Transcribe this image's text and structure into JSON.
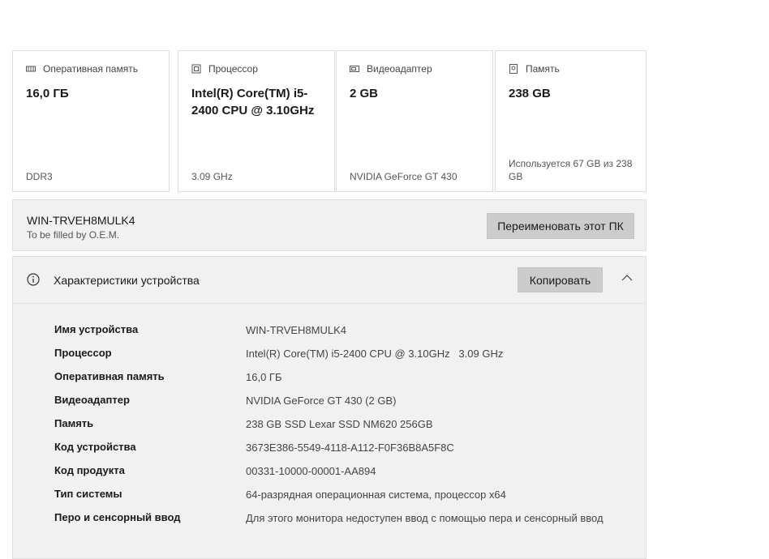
{
  "cards": [
    {
      "icon": "memory-icon",
      "label": "Оперативная память",
      "value": "16,0 ГБ",
      "sub": "DDR3"
    },
    {
      "icon": "processor-icon",
      "label": "Процессор",
      "value": "Intel(R) Core(TM) i5-2400 CPU @ 3.10GHz",
      "sub": "3.09 GHz"
    },
    {
      "icon": "gpu-icon",
      "label": "Видеоадаптер",
      "value": "2 GB",
      "sub": "NVIDIA GeForce GT 430"
    },
    {
      "icon": "storage-icon",
      "label": "Память",
      "value": "238 GB",
      "sub": "Используется 67 GB из 238 GB"
    }
  ],
  "pc": {
    "name": "WIN-TRVEH8MULK4",
    "oem": "To be filled by O.E.M.",
    "rename_label": "Переименовать этот ПК"
  },
  "specs": {
    "title": "Характеристики устройства",
    "copy_label": "Копировать",
    "rows": [
      {
        "k": "Имя устройства",
        "v": "WIN-TRVEH8MULK4"
      },
      {
        "k": "Процессор",
        "v": "Intel(R) Core(TM) i5-2400 CPU @ 3.10GHz   3.09 GHz"
      },
      {
        "k": "Оперативная память",
        "v": "16,0 ГБ"
      },
      {
        "k": "Видеоадаптер",
        "v": "NVIDIA GeForce GT 430 (2 GB)"
      },
      {
        "k": "Память",
        "v": "238 GB SSD Lexar SSD NM620 256GB"
      },
      {
        "k": "Код устройства",
        "v": "3673E386-5549-4118-A112-F0F36B8A5F8C"
      },
      {
        "k": "Код продукта",
        "v": "00331-10000-00001-AA894"
      },
      {
        "k": "Тип системы",
        "v": "64-разрядная операционная система, процессор x64"
      },
      {
        "k": "Перо и сенсорный ввод",
        "v": "Для этого монитора недоступен ввод с помощью пера и сенсорный ввод"
      }
    ]
  }
}
